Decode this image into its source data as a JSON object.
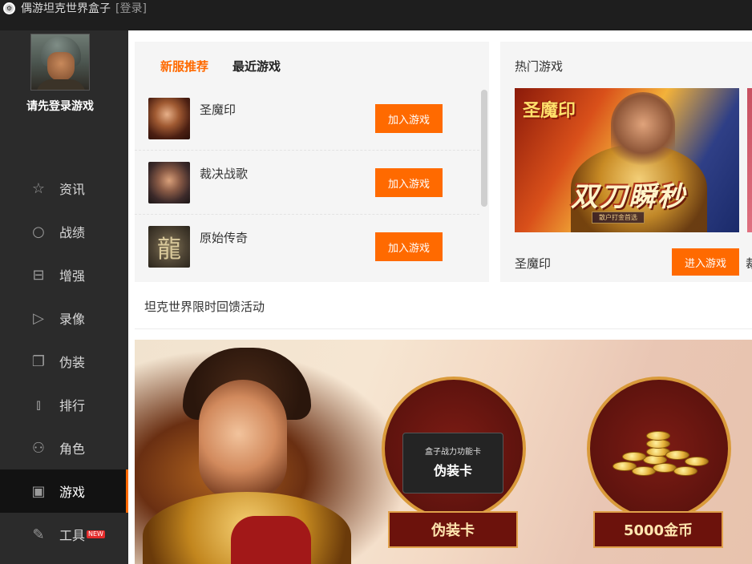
{
  "titlebar": {
    "app_title": "偶游坦克世界盒子",
    "login_link": "[登录]"
  },
  "sidebar": {
    "login_prompt": "请先登录游戏",
    "items": [
      {
        "label": "资讯",
        "icon": "star-icon",
        "glyph": "☆",
        "active": false
      },
      {
        "label": "战绩",
        "icon": "search-icon",
        "glyph": "○",
        "active": false
      },
      {
        "label": "增强",
        "icon": "briefcase-icon",
        "glyph": "⊟",
        "active": false
      },
      {
        "label": "录像",
        "icon": "play-icon",
        "glyph": "▷",
        "active": false
      },
      {
        "label": "伪装",
        "icon": "layers-icon",
        "glyph": "❐",
        "active": false
      },
      {
        "label": "排行",
        "icon": "bar-chart-icon",
        "glyph": "⫾",
        "active": false
      },
      {
        "label": "角色",
        "icon": "user-icon",
        "glyph": "⚇",
        "active": false
      },
      {
        "label": "游戏",
        "icon": "gamepad-icon",
        "glyph": "▣",
        "active": true
      },
      {
        "label": "工具",
        "icon": "wrench-icon",
        "glyph": "✎",
        "active": false,
        "badge": "NEW"
      }
    ]
  },
  "game_panel": {
    "tabs": [
      {
        "label": "新服推荐",
        "active": true
      },
      {
        "label": "最近游戏",
        "active": false
      }
    ],
    "games": [
      {
        "name": "圣魔印",
        "button": "加入游戏"
      },
      {
        "name": "裁决战歌",
        "button": "加入游戏"
      },
      {
        "name": "原始传奇",
        "button": "加入游戏",
        "thumb_glyph": "龍"
      }
    ]
  },
  "hot_games": {
    "title": "热门游戏",
    "banner": {
      "logo": "圣魔印",
      "slogan": "双刀瞬秒",
      "sub": "散户打金首选"
    },
    "game_name": "圣魔印",
    "enter_button": "进入游戏",
    "partial_name": "裁"
  },
  "event": {
    "title": "坦克世界限时回馈活动",
    "prizes": [
      {
        "card_title": "盒子战力功能卡",
        "card_name": "伪装卡",
        "label": "伪装卡"
      },
      {
        "label": "5000金币"
      }
    ]
  },
  "colors": {
    "accent": "#ff6a00",
    "sidebar_bg": "#2b2b2b",
    "titlebar_bg": "#1e1e1e",
    "panel_bg": "#f5f5f5"
  }
}
